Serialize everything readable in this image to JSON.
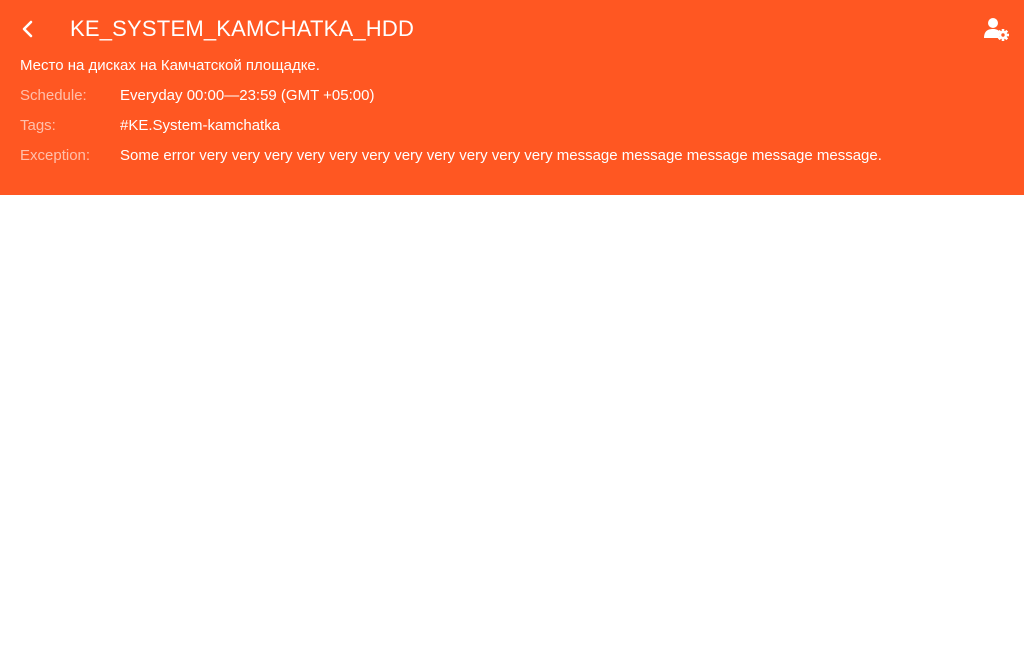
{
  "header": {
    "title": "KE_SYSTEM_KAMCHATKA_HDD",
    "description": "Место на дисках на Камчатской площадке.",
    "back_icon": "chevron-left-icon",
    "settings_icon": "user-settings-icon",
    "background_color": "#ff5722"
  },
  "details": {
    "schedule": {
      "label": "Schedule:",
      "value": "Everyday 00:00—23:59 (GMT +05:00)"
    },
    "tags": {
      "label": "Tags:",
      "value": "#KE.System-kamchatka"
    },
    "exception": {
      "label": "Exception:",
      "value": "Some error very very very very very very very very very very very message message message message message."
    }
  }
}
